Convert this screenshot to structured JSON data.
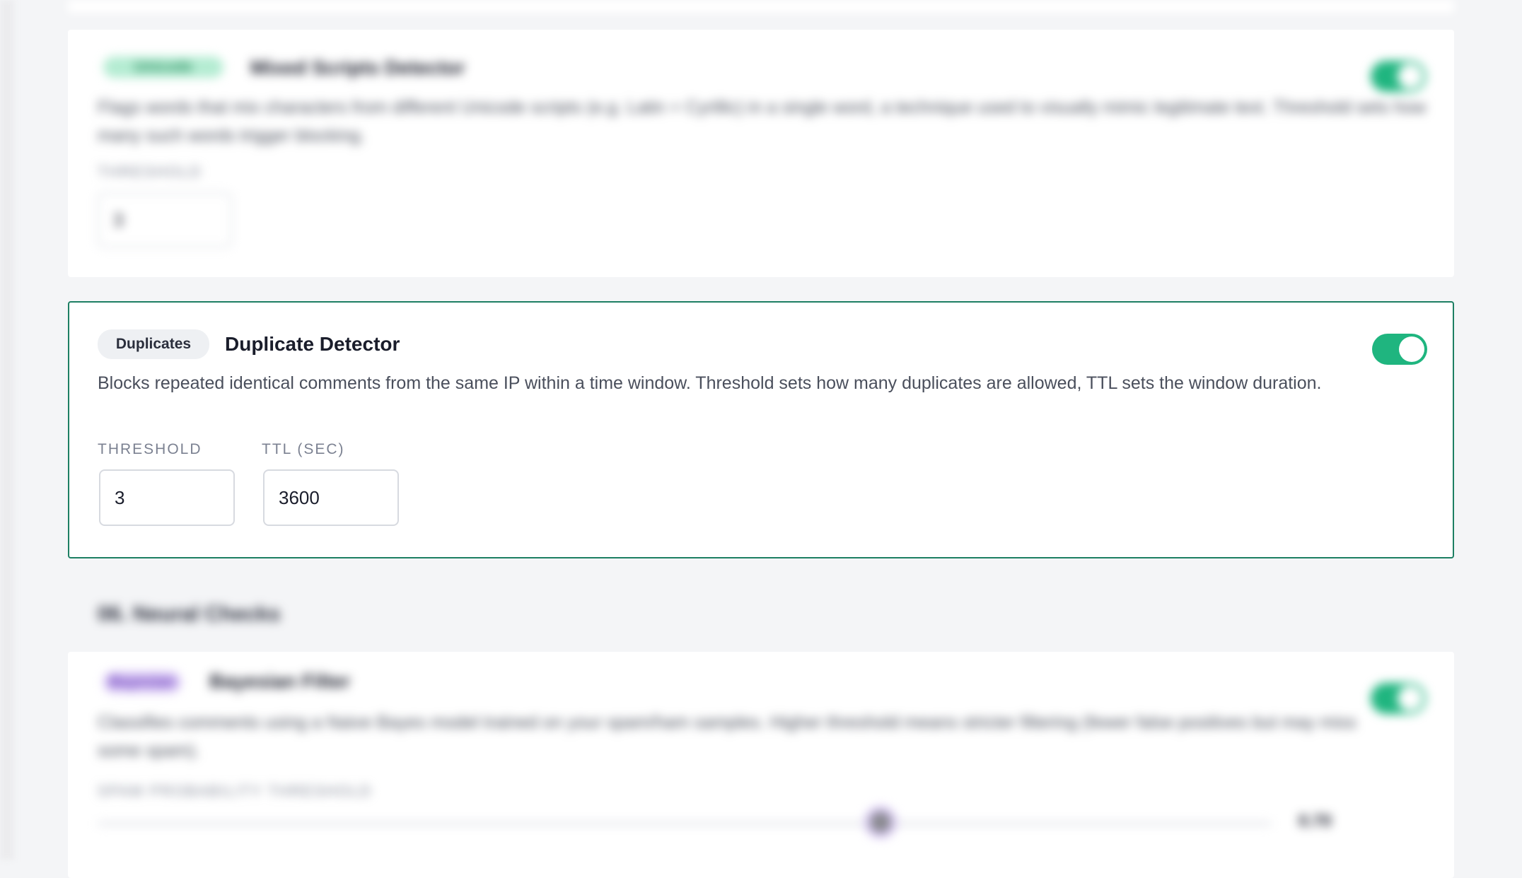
{
  "cards": {
    "top": {
      "tag": "Unicode",
      "title": "Mixed Scripts Detector",
      "description": "Flags words that mix characters from different Unicode scripts (e.g. Latin + Cyrillic) in a single word, a technique used to visually mimic legitimate text. Threshold sets how many such words trigger blocking.",
      "threshold_label": "THRESHOLD",
      "threshold_value": "3"
    },
    "focused": {
      "tag": "Duplicates",
      "title": "Duplicate Detector",
      "description": "Blocks repeated identical comments from the same IP within a time window. Threshold sets how many duplicates are allowed, TTL sets the window duration.",
      "threshold_label": "THRESHOLD",
      "threshold_value": "3",
      "ttl_label": "TTL (SEC)",
      "ttl_value": "3600",
      "enabled": true
    },
    "bottom": {
      "section_title": "06. Neural Checks",
      "tag": "Bayesian",
      "title": "Bayesian Filter",
      "description": "Classifies comments using a Naive Bayes model trained on your spam/ham samples. Higher threshold means stricter filtering (fewer false positives but may miss some spam).",
      "threshold_label": "SPAM PROBABILITY THRESHOLD",
      "threshold_value": "0.70",
      "slider_fraction": 0.7
    }
  },
  "colors": {
    "accent": "#1fb57f",
    "focus_border": "#1d7f63",
    "tag_bg": "#eef0f3",
    "unicode_tag": "#b4ecd2",
    "bayesian_tag": "#d6c3f5"
  }
}
